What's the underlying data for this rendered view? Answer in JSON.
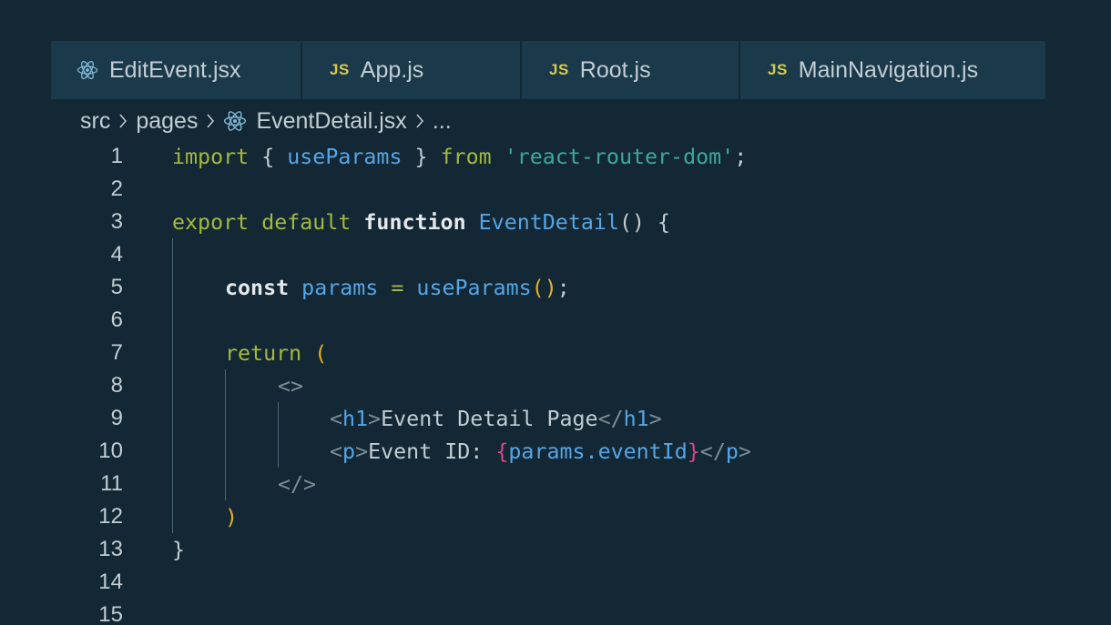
{
  "tabs": [
    {
      "label": "EditEvent.jsx",
      "icon": "react-icon"
    },
    {
      "label": "App.js",
      "icon": "js-icon",
      "icon_text": "JS"
    },
    {
      "label": "Root.js",
      "icon": "js-icon",
      "icon_text": "JS"
    },
    {
      "label": "MainNavigation.js",
      "icon": "js-icon",
      "icon_text": "JS"
    }
  ],
  "breadcrumb": {
    "items": [
      "src",
      "pages",
      "EventDetail.jsx",
      "..."
    ],
    "file_icon": "react-icon"
  },
  "editor": {
    "line_numbers": [
      "1",
      "2",
      "3",
      "4",
      "5",
      "6",
      "7",
      "8",
      "9",
      "10",
      "11",
      "12",
      "13",
      "14",
      "15"
    ],
    "tokens": {
      "import": "import",
      "brace_open": "{",
      "use_params": "useParams",
      "brace_close": "}",
      "from": "from",
      "module": "'react-router-dom'",
      "semi": ";",
      "export": "export",
      "default": "default",
      "function": "function",
      "component": "EventDetail",
      "paren_pair": "()",
      "const": "const",
      "params": "params",
      "equals": "=",
      "paren_open": "(",
      "paren_close": ")",
      "return": "return",
      "frag_open": "<>",
      "lt": "<",
      "gt": ">",
      "lt_slash": "</",
      "h1": "h1",
      "h1_text": "Event Detail Page",
      "p": "p",
      "p_text": "Event ID: ",
      "params_event_id": "params.eventId",
      "frag_close": "</>"
    }
  },
  "colors": {
    "background": "#132834",
    "tab_background": "#1a3a4b",
    "keyword": "#a4b83f",
    "function_name": "#56a5e6",
    "string": "#3ba99c",
    "bracket_yellow": "#e0b12e",
    "bracket_pink": "#e0428a",
    "js_icon": "#d8c94f"
  }
}
